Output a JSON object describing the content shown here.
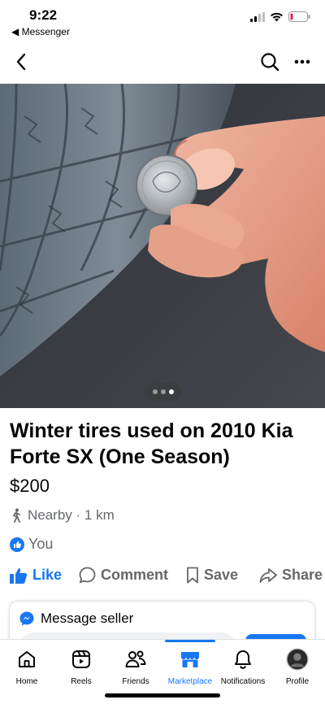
{
  "status_bar": {
    "time": "9:22",
    "back_app": "Messenger"
  },
  "listing": {
    "title": "Winter tires used on 2010 Kia Forte SX (One Season)",
    "price": "$200",
    "location": "Nearby · 1 km",
    "liked_by": "You",
    "photo_pages": 3,
    "photo_current": 3
  },
  "actions": {
    "like": "Like",
    "comment": "Comment",
    "save": "Save",
    "share": "Share"
  },
  "message_card": {
    "heading": "Message seller"
  },
  "tabbar": {
    "home": "Home",
    "reels": "Reels",
    "friends": "Friends",
    "marketplace": "Marketplace",
    "notifications": "Notifications",
    "profile": "Profile",
    "active": "marketplace"
  },
  "colors": {
    "accent": "#1877f2",
    "secondary_text": "#65676b",
    "battery_low": "#e0245e"
  }
}
